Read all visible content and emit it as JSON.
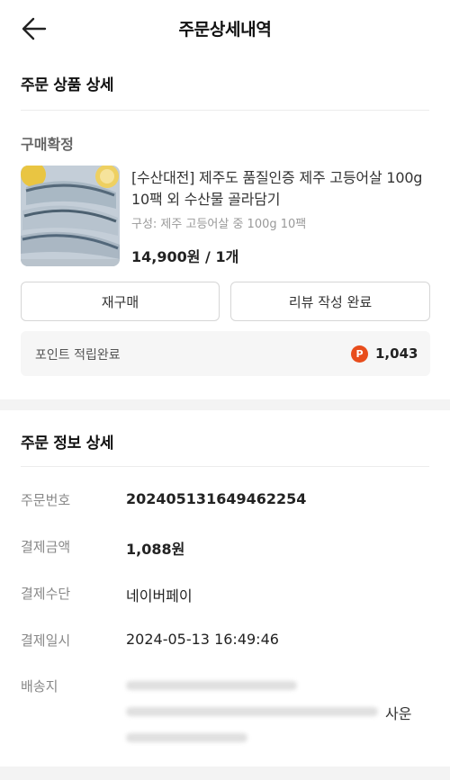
{
  "header": {
    "title": "주문상세내역",
    "back_icon": "arrow-left-icon"
  },
  "product_section": {
    "title": "주문 상품 상세",
    "status": "구매확정",
    "product": {
      "name": "[수산대전] 제주도 품질인증 제주 고등어살 100g 10팩 외 수산물 골라담기",
      "option": "구성: 제주 고등어살 중 100g 10팩",
      "price": "14,900원 / 1개"
    },
    "buttons": {
      "rebuy": "재구매",
      "review": "리뷰 작성 완료"
    },
    "point": {
      "label": "포인트 적립완료",
      "icon": "P",
      "value": "1,043",
      "icon_color": "#e84d1c"
    }
  },
  "order_info_section": {
    "title": "주문 정보 상세",
    "rows": [
      {
        "label": "주문번호",
        "value": "202405131649462254"
      },
      {
        "label": "결제금액",
        "value": "1,088원"
      },
      {
        "label": "결제수단",
        "value": "네이버페이"
      },
      {
        "label": "결제일시",
        "value": "2024-05-13 16:49:46"
      },
      {
        "label": "배송지",
        "value_visible_suffix": "사운"
      }
    ]
  }
}
